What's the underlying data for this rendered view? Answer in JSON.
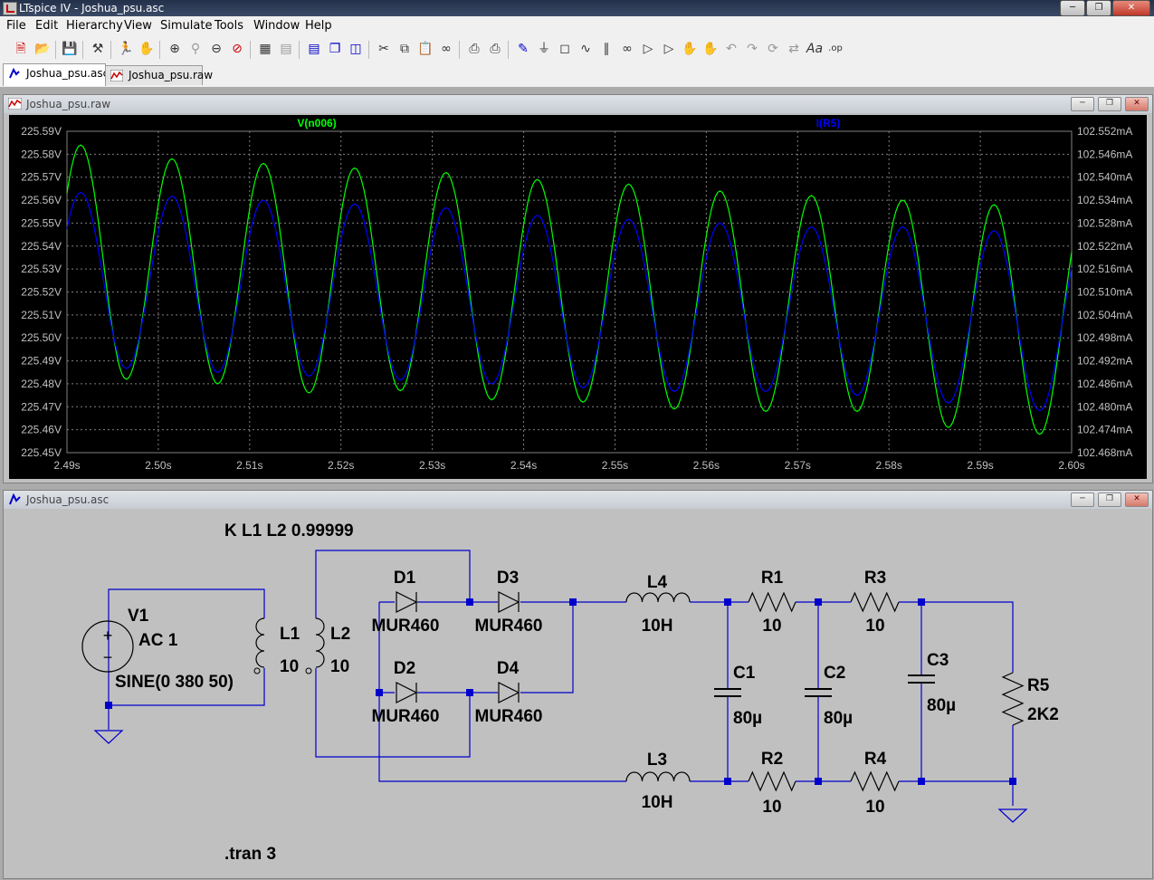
{
  "window": {
    "title": "LTspice IV - Joshua_psu.asc"
  },
  "menu": [
    "File",
    "Edit",
    "Hierarchy",
    "View",
    "Simulate",
    "Tools",
    "Window",
    "Help"
  ],
  "toolbar_icons": [
    "new-schematic-icon",
    "open-icon",
    "save-icon",
    "control-panel-icon",
    "run-icon",
    "halt-icon",
    "zoom-in-icon",
    "zoom-area-icon",
    "zoom-out-icon",
    "zoom-cancel-icon",
    "autorange-icon",
    "manual-limits-icon",
    "tile-horizontal-icon",
    "cascade-icon",
    "tile-vertical-icon",
    "cut-icon",
    "copy-icon",
    "paste-icon",
    "find-icon",
    "print-preview-icon",
    "print-icon",
    "wire-icon",
    "ground-icon",
    "label-icon",
    "resistor-icon",
    "capacitor-icon",
    "inductor-icon",
    "diode-icon",
    "component-icon",
    "move-icon",
    "drag-icon",
    "undo-icon",
    "redo-icon",
    "rotate-icon",
    "mirror-icon",
    "text-icon",
    "spice-directive-icon"
  ],
  "tabs": [
    {
      "label": "Joshua_psu.asc"
    },
    {
      "label": "Joshua_psu.raw"
    }
  ],
  "plot_window": {
    "title": "Joshua_psu.raw"
  },
  "schematic_window": {
    "title": "Joshua_psu.asc"
  },
  "colors": {
    "background": "#000000",
    "trace1": "#00ff00",
    "trace2": "#0000ff",
    "grid": "#808080",
    "axis_text": "#c0c0c0",
    "wire": "#0000cc",
    "component": "#000000"
  },
  "chart_data": {
    "type": "line",
    "xlabel": "",
    "xlim": [
      2.49,
      2.6
    ],
    "x_ticks": [
      "2.49s",
      "2.50s",
      "2.51s",
      "2.52s",
      "2.53s",
      "2.54s",
      "2.55s",
      "2.56s",
      "2.57s",
      "2.58s",
      "2.59s",
      "2.60s"
    ],
    "left_axis": {
      "ylim": [
        225.45,
        225.59
      ],
      "ticks": [
        "225.59V",
        "225.58V",
        "225.57V",
        "225.56V",
        "225.55V",
        "225.54V",
        "225.53V",
        "225.52V",
        "225.51V",
        "225.50V",
        "225.49V",
        "225.48V",
        "225.47V",
        "225.46V",
        "225.45V"
      ]
    },
    "right_axis": {
      "ylim": [
        102.468,
        102.552
      ],
      "ticks": [
        "102.552mA",
        "102.546mA",
        "102.540mA",
        "102.534mA",
        "102.528mA",
        "102.522mA",
        "102.516mA",
        "102.510mA",
        "102.504mA",
        "102.498mA",
        "102.492mA",
        "102.486mA",
        "102.480mA",
        "102.474mA",
        "102.468mA"
      ]
    },
    "grid": true,
    "series": [
      {
        "name": "V(n006)",
        "axis": "left",
        "color": "#00ff00",
        "frequency_hz": 100,
        "peak_time_s": 2.4915,
        "peaks": [
          225.584,
          225.578,
          225.576,
          225.574,
          225.572,
          225.569,
          225.567,
          225.564,
          225.562,
          225.56,
          225.558
        ],
        "troughs": [
          225.482,
          225.48,
          225.476,
          225.477,
          225.473,
          225.472,
          225.469,
          225.468,
          225.468,
          225.461,
          225.458
        ]
      },
      {
        "name": "I(R5)",
        "axis": "right",
        "color": "#0000ff",
        "frequency_hz": 100,
        "peak_time_s": 2.4915,
        "peaks": [
          102.536,
          102.535,
          102.534,
          102.533,
          102.532,
          102.53,
          102.529,
          102.528,
          102.527,
          102.527,
          102.526
        ],
        "troughs": [
          102.49,
          102.489,
          102.488,
          102.487,
          102.486,
          102.485,
          102.484,
          102.484,
          102.483,
          102.481,
          102.479
        ]
      }
    ]
  },
  "schematic": {
    "directive_k": "K L1 L2 0.99999",
    "directive_tran": ".tran 3",
    "components": [
      {
        "ref": "V1",
        "value": "AC 1",
        "extra": "SINE(0 380 50)"
      },
      {
        "ref": "L1",
        "value": "10"
      },
      {
        "ref": "L2",
        "value": "10"
      },
      {
        "ref": "D1",
        "value": "MUR460"
      },
      {
        "ref": "D2",
        "value": "MUR460"
      },
      {
        "ref": "D3",
        "value": "MUR460"
      },
      {
        "ref": "D4",
        "value": "MUR460"
      },
      {
        "ref": "L4",
        "value": "10H"
      },
      {
        "ref": "L3",
        "value": "10H"
      },
      {
        "ref": "R1",
        "value": "10"
      },
      {
        "ref": "R2",
        "value": "10"
      },
      {
        "ref": "R3",
        "value": "10"
      },
      {
        "ref": "R4",
        "value": "10"
      },
      {
        "ref": "C1",
        "value": "80µ"
      },
      {
        "ref": "C2",
        "value": "80µ"
      },
      {
        "ref": "C3",
        "value": "80µ"
      },
      {
        "ref": "R5",
        "value": "2K2"
      }
    ]
  }
}
